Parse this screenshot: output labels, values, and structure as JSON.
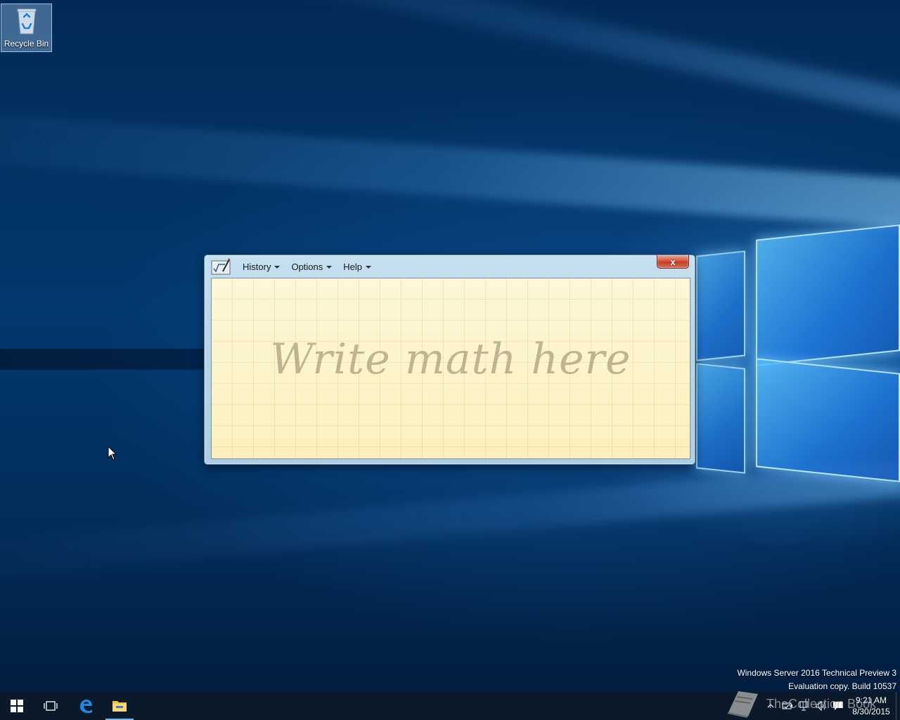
{
  "desktop": {
    "icons": [
      {
        "label": "Recycle Bin",
        "icon": "recycle-bin-icon"
      }
    ]
  },
  "window": {
    "app_icon": "math-input-panel-icon",
    "menus": [
      {
        "label": "History"
      },
      {
        "label": "Options"
      },
      {
        "label": "Help"
      }
    ],
    "close_label": "x",
    "writing_hint": "Write math here"
  },
  "watermark": {
    "line1": "Windows Server 2016 Technical Preview 3",
    "line2": "Evaluation copy. Build 10537"
  },
  "taskbar": {
    "start_icon": "windows-logo-icon",
    "buttons": [
      {
        "name": "task-view",
        "icon": "task-view-icon"
      },
      {
        "name": "edge",
        "icon": "edge-browser-icon"
      },
      {
        "name": "file-explorer",
        "icon": "folder-icon"
      }
    ],
    "tray": {
      "time": "9:21 AM",
      "date": "8/30/2015",
      "icons": [
        "chevron-up-icon",
        "battery-icon",
        "network-icon",
        "volume-icon",
        "action-center-icon"
      ]
    }
  },
  "site_mark": {
    "text": "TheCollection Book"
  },
  "colors": {
    "writing_area": "#fdf4c9",
    "window_frame": "#b7d6ea",
    "close_button": "#c23b22",
    "taskbar": "#0a1a2b"
  }
}
